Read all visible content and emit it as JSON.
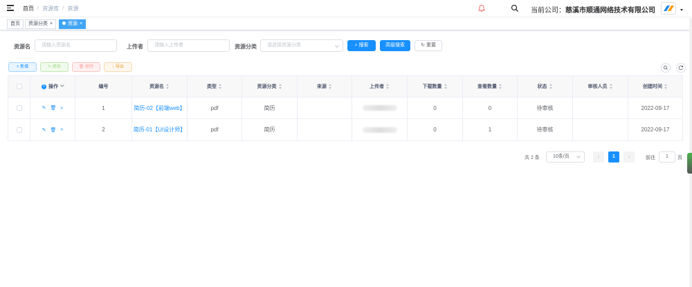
{
  "breadcrumb": [
    "首页",
    "资源库",
    "资源"
  ],
  "header": {
    "company_label": "当前公司：",
    "company_name": "慈溪市顺通网络技术有限公司"
  },
  "tags": [
    {
      "label": "首页",
      "closable": false
    },
    {
      "label": "资源分类",
      "closable": true
    },
    {
      "label": "资源",
      "closable": true,
      "active": true
    }
  ],
  "filters": {
    "name_label": "资源名",
    "name_placeholder": "请输入资源名",
    "uploader_label": "上传者",
    "uploader_placeholder": "请输入上传者",
    "category_label": "资源分类",
    "category_placeholder": "请选择资源分类",
    "search_btn": "搜索",
    "adv_search_btn": "高级搜索",
    "reset_btn": "重置"
  },
  "toolbar": {
    "add": "新增",
    "edit": "修改",
    "delete": "删除",
    "export": "导出"
  },
  "table": {
    "headers": [
      "操作",
      "编号",
      "资源名",
      "类型",
      "资源分类",
      "来源",
      "上传者",
      "下载数量",
      "查看数量",
      "状态",
      "审核人员",
      "创建时间"
    ],
    "rows": [
      {
        "id": "1",
        "name": "简历-02【前端web】",
        "type": "pdf",
        "category": "简历",
        "source": "",
        "downloads": "0",
        "views": "0",
        "status": "待审核",
        "reviewer": "",
        "created": "2022-09-17"
      },
      {
        "id": "2",
        "name": "简历-01【UI设计师】",
        "type": "pdf",
        "category": "简历",
        "source": "",
        "downloads": "0",
        "views": "1",
        "status": "待审核",
        "reviewer": "",
        "created": "2022-09-17"
      }
    ]
  },
  "pagination": {
    "total": "共 2 条",
    "page_size": "10条/页",
    "current": "1",
    "goto_label": "前往",
    "goto_value": "1",
    "page_suffix": "页"
  },
  "colors": {
    "primary": "#1890ff",
    "tag_active": "#42a5f5",
    "alert": "#f56c6c"
  },
  "icons": [
    "menu-icon",
    "bell-icon",
    "search-icon",
    "info-icon",
    "edit-icon",
    "delete-icon",
    "more-icon",
    "refresh-icon"
  ]
}
